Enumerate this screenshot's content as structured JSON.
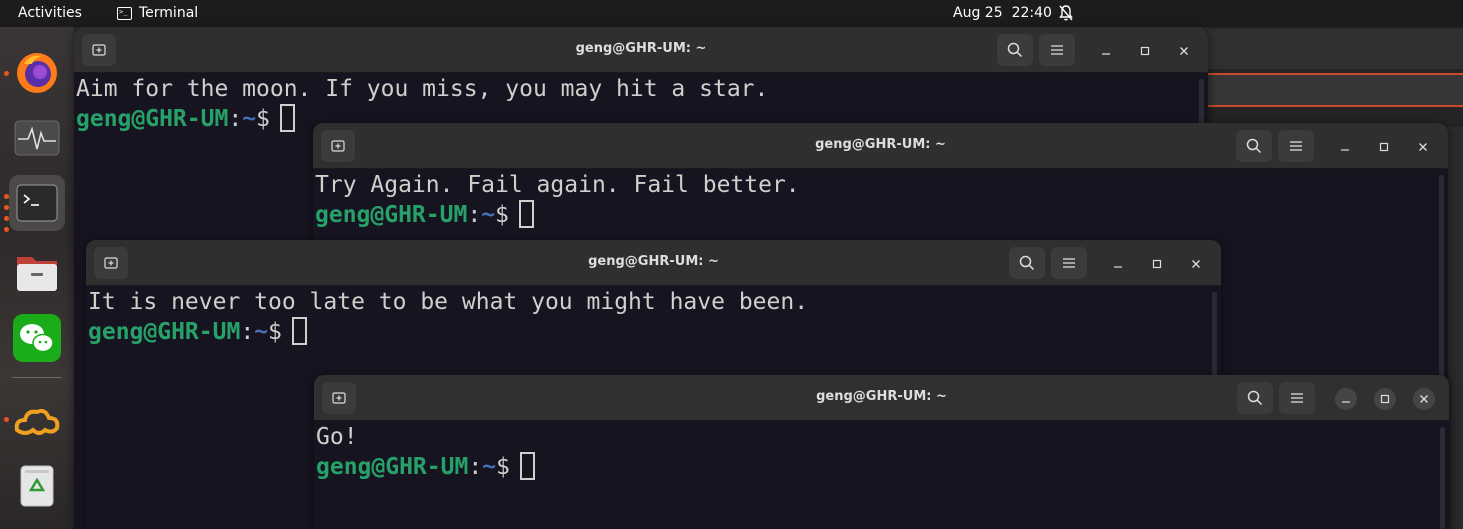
{
  "topbar": {
    "activities": "Activities",
    "app_name": "Terminal",
    "date": "Aug 25",
    "time": "22:40"
  },
  "dock": {
    "items": [
      {
        "name": "Firefox",
        "icon": "firefox-icon"
      },
      {
        "name": "System Monitor",
        "icon": "system-monitor-icon"
      },
      {
        "name": "Terminal",
        "icon": "terminal-icon"
      },
      {
        "name": "Files",
        "icon": "files-icon"
      },
      {
        "name": "WeChat",
        "icon": "wechat-icon"
      },
      {
        "name": "Cloud app",
        "icon": "cloud-app-icon"
      },
      {
        "name": "Trash",
        "icon": "trash-icon"
      }
    ]
  },
  "windows": [
    {
      "title": "geng@GHR-UM: ~",
      "output": "Aim for the moon. If you miss, you may hit a star.",
      "user_host": "geng@GHR-UM",
      "sep": ":",
      "path": "~",
      "prompt": "$"
    },
    {
      "title": "geng@GHR-UM: ~",
      "output": "Try Again. Fail again. Fail better.",
      "user_host": "geng@GHR-UM",
      "sep": ":",
      "path": "~",
      "prompt": "$"
    },
    {
      "title": "geng@GHR-UM: ~",
      "output": "It is never too late to be what you might have been.",
      "user_host": "geng@GHR-UM",
      "sep": ":",
      "path": "~",
      "prompt": "$"
    },
    {
      "title": "geng@GHR-UM: ~",
      "output": "Go!",
      "user_host": "geng@GHR-UM",
      "sep": ":",
      "path": "~",
      "prompt": "$"
    }
  ],
  "colors": {
    "terminal_bg": "#171421",
    "prompt_user": "#26a269",
    "prompt_path": "#4a6fb5",
    "accent": "#e95420"
  }
}
